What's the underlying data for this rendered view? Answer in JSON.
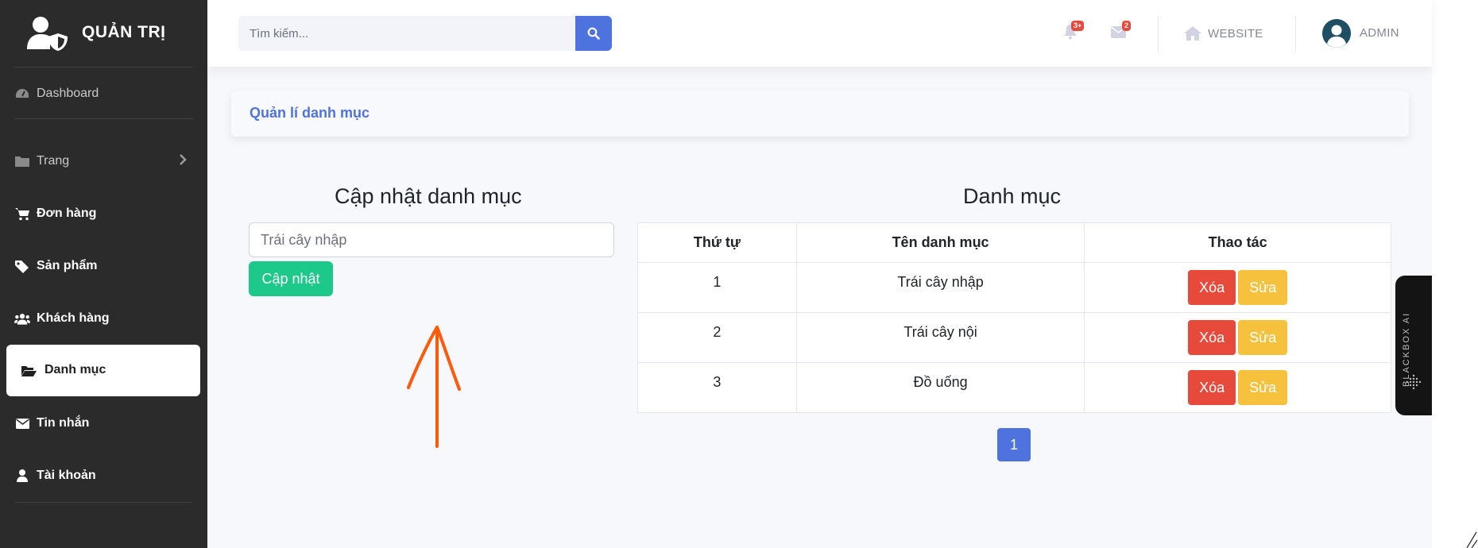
{
  "brand": {
    "title": "QUẢN TRỊ",
    "icon": "user-shield-icon"
  },
  "sidebar": {
    "items": [
      {
        "label": "Dashboard",
        "icon": "dashboard-icon"
      },
      {
        "label": "Trang",
        "icon": "folder-icon"
      },
      {
        "label": "Đơn hàng",
        "icon": "cart-icon"
      },
      {
        "label": "Sản phẩm",
        "icon": "tags-icon"
      },
      {
        "label": "Khách hàng",
        "icon": "users-icon"
      },
      {
        "label": "Danh mục",
        "icon": "folder-open-icon",
        "active": true
      },
      {
        "label": "Tin nhắn",
        "icon": "envelope-icon"
      },
      {
        "label": "Tài khoản",
        "icon": "user-icon"
      }
    ]
  },
  "topbar": {
    "search_placeholder": "Tìm kiếm...",
    "alerts_badge": "3+",
    "messages_badge": "2",
    "website_label": "WEBSITE",
    "user_label": "ADMIN"
  },
  "page": {
    "header_title": "Quản lí danh mục"
  },
  "update_form": {
    "title": "Cập nhật danh mục",
    "input_value": "Trái cây nhập",
    "button_label": "Cập nhật"
  },
  "category_table": {
    "title": "Danh mục",
    "headers": [
      "Thứ tự",
      "Tên danh mục",
      "Thao tác"
    ],
    "rows": [
      {
        "index": "1",
        "name": "Trái cây nhập",
        "delete_label": "Xóa",
        "edit_label": "Sửa"
      },
      {
        "index": "2",
        "name": "Trái cây nội",
        "delete_label": "Xóa",
        "edit_label": "Sửa"
      },
      {
        "index": "3",
        "name": "Đồ uống",
        "delete_label": "Xóa",
        "edit_label": "Sửa"
      }
    ]
  },
  "pagination": {
    "current": "1"
  },
  "side_widget": {
    "label": "BLACKBOX AI"
  },
  "colors": {
    "sidebar_bg": "#2b2b2b",
    "primary": "#4e73df",
    "success": "#1cc88a",
    "danger": "#e74a3b",
    "warning": "#f6c23e",
    "annotation_arrow": "#ff5a0a"
  }
}
